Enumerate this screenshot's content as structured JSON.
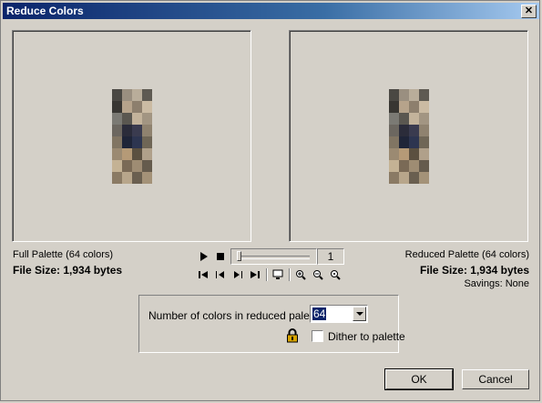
{
  "window": {
    "title": "Reduce Colors",
    "close_label": "✕"
  },
  "left_panel": {
    "palette_label": "Full Palette  (64 colors)",
    "file_size": "File Size: 1,934 bytes"
  },
  "right_panel": {
    "palette_label": "Reduced Palette  (64 colors)",
    "file_size": "File Size: 1,934 bytes",
    "savings": "Savings: None"
  },
  "playback": {
    "frame": "1"
  },
  "options": {
    "colors_label": "Number of colors in reduced palette:",
    "colors_value": "64",
    "dither_label": "Dither to palette",
    "dither_checked": false
  },
  "buttons": {
    "ok": "OK",
    "cancel": "Cancel"
  },
  "colors": {
    "title_start": "#0a246a",
    "title_end": "#a6caf0",
    "face": "#d4d0c8"
  }
}
